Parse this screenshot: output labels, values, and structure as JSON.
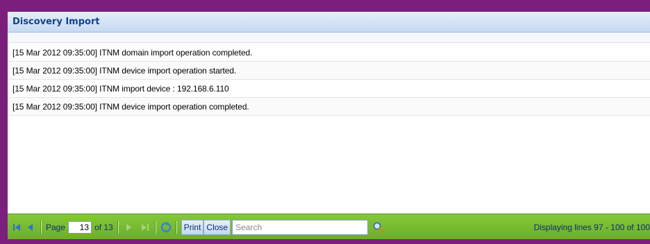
{
  "window": {
    "title": "Discovery Import"
  },
  "log": {
    "lines": [
      "[15 Mar 2012 09:35:00] ITNM domain import operation completed.",
      "[15 Mar 2012 09:35:00] ITNM device import operation started.",
      "[15 Mar 2012 09:35:00] ITNM import device : 192.168.6.110",
      "[15 Mar 2012 09:35:00] ITNM device import operation completed."
    ]
  },
  "paging": {
    "page_label": "Page",
    "current_page": "13",
    "of_label": "of 13",
    "status": "Displaying lines 97 - 100 of 100"
  },
  "toolbar": {
    "print_label": "Print",
    "close_label": "Close",
    "search_placeholder": "Search"
  },
  "icons": {
    "first": "first-page-icon",
    "prev": "prev-page-icon",
    "next": "next-page-icon",
    "last": "last-page-icon",
    "refresh": "refresh-icon",
    "search": "magnifier-icon"
  },
  "colors": {
    "frame": "#7b1f7d",
    "title_text": "#15428b",
    "toolbar": "#78bb32"
  }
}
